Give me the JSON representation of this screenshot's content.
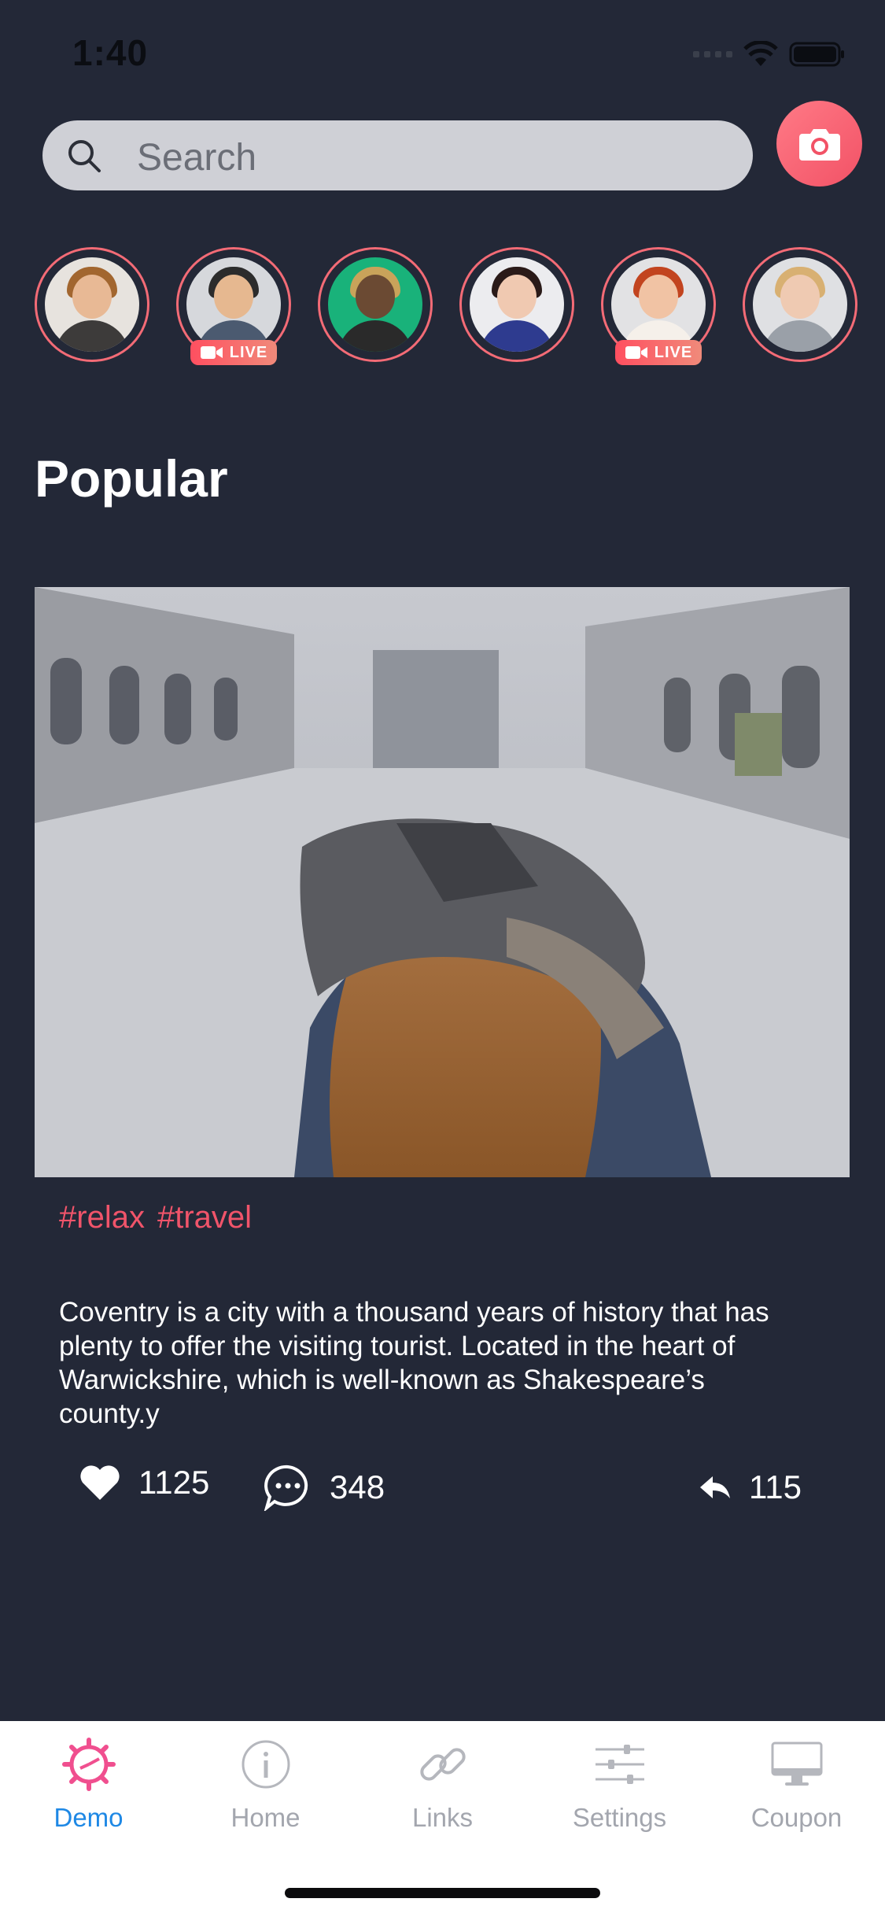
{
  "status_bar": {
    "time": "1:40"
  },
  "search": {
    "placeholder": "Search"
  },
  "stories": [
    {
      "name": "story-1",
      "live": false
    },
    {
      "name": "story-2",
      "live": true,
      "live_label": "LIVE"
    },
    {
      "name": "story-3",
      "live": false
    },
    {
      "name": "story-4",
      "live": false
    },
    {
      "name": "story-5",
      "live": true,
      "live_label": "LIVE"
    },
    {
      "name": "story-6",
      "live": false
    }
  ],
  "live_label": "LIVE",
  "section": {
    "title": "Popular"
  },
  "post": {
    "tags": [
      "#relax",
      "#travel"
    ],
    "text": "Coventry is a city with a thousand years of history that has plenty to offer the visiting tourist. Located in the heart of Warwickshire, which is well-known as Shakespeare’s county.y",
    "likes": "1125",
    "comments": "348",
    "shares": "115"
  },
  "tabbar": {
    "items": [
      {
        "label": "Demo",
        "icon": "gear-icon",
        "active": true
      },
      {
        "label": "Home",
        "icon": "info-icon",
        "active": false
      },
      {
        "label": "Links",
        "icon": "link-icon",
        "active": false
      },
      {
        "label": "Settings",
        "icon": "sliders-icon",
        "active": false
      },
      {
        "label": "Coupon",
        "icon": "monitor-icon",
        "active": false
      }
    ]
  },
  "colors": {
    "background": "#232837",
    "accent": "#f0546a",
    "active_tab": "#1e88e5"
  }
}
